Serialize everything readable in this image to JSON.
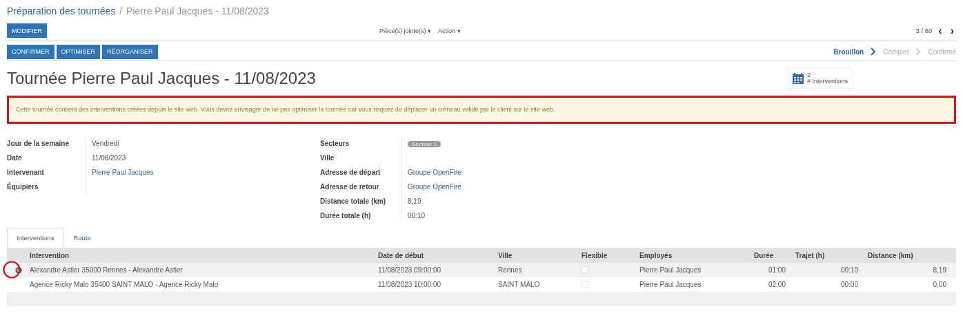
{
  "breadcrumb": {
    "parent": "Préparation des tournées",
    "separator": "/",
    "current": "Pierre Paul Jacques - 11/08/2023"
  },
  "edit_button": "MODIFIER",
  "menus": [
    {
      "label": "Pièce(s) jointe(s)",
      "caret": "▾"
    },
    {
      "label": "Action",
      "caret": "▾"
    }
  ],
  "pager": {
    "text": "3 / 80",
    "prev": "‹",
    "next": "›"
  },
  "action_buttons": [
    "CONFIRMER",
    "OPTIMISER",
    "RÉORGANISER"
  ],
  "status_steps": [
    {
      "label": "Brouillon",
      "selected": true
    },
    {
      "label": "Complet",
      "selected": false
    },
    {
      "label": "Confirmé",
      "selected": false
    }
  ],
  "title": "Tournée Pierre Paul Jacques - 11/08/2023",
  "stat_button": {
    "value": "2",
    "label": "# Interventions"
  },
  "alert": {
    "text": "Cette tournée contient des interventions créées depuis le site web. Vous devez envisager de ne pas optimiser la tournée car vous risquez de déplacer un créneau validé par le client sur le site web.",
    "highlighted": true
  },
  "left_fields": [
    {
      "label": "Jour de la semaine",
      "value": "Vendredi",
      "kind": "text"
    },
    {
      "label": "Date",
      "value": "11/08/2023",
      "kind": "text"
    },
    {
      "label": "Intervenant",
      "value": "Pierre Paul Jacques",
      "kind": "link"
    },
    {
      "label": "Équipiers"
    }
  ],
  "right_fields": [
    {
      "label": "Secteurs",
      "value": "Secteur 1",
      "kind": "tag"
    },
    {
      "label": "Ville"
    },
    {
      "label": "Adresse de départ",
      "value": "Groupe OpenFire",
      "kind": "link"
    },
    {
      "label": "Adresse de retour",
      "value": "Groupe OpenFire",
      "kind": "link"
    },
    {
      "label": "Distance totale (km)",
      "value": "8,19",
      "kind": "text"
    },
    {
      "label": "Durée totale (h)",
      "value": "00:10",
      "kind": "text"
    }
  ],
  "tabs": [
    {
      "label": "Interventions",
      "selected": true
    },
    {
      "label": "Route",
      "selected": false
    }
  ],
  "table": {
    "columns": [
      "Intervention",
      "Date de début",
      "Ville",
      "Flexible",
      "Employés",
      "Durée",
      "Trajet (h)",
      "Distance (km)"
    ],
    "rows": [
      {
        "web": true,
        "highlighted": true,
        "intervention": "Alexandre Astier 35000 Rennes - Alexandre Astier",
        "date": "11/08/2023 09:00:00",
        "ville": "Rennes",
        "flexible": false,
        "employes": "Pierre Paul Jacques",
        "duree": "01:00",
        "trajet": "00:10",
        "distance": "8,19"
      },
      {
        "web": false,
        "highlighted": false,
        "intervention": "Agence Ricky Malo 35400 SAINT MALO - Agence Ricky Malo",
        "date": "11/08/2023 10:00:00",
        "ville": "SAINT MALO",
        "flexible": false,
        "employes": "Pierre Paul Jacques",
        "duree": "02:00",
        "trajet": "00:00",
        "distance": "0,00"
      }
    ]
  }
}
